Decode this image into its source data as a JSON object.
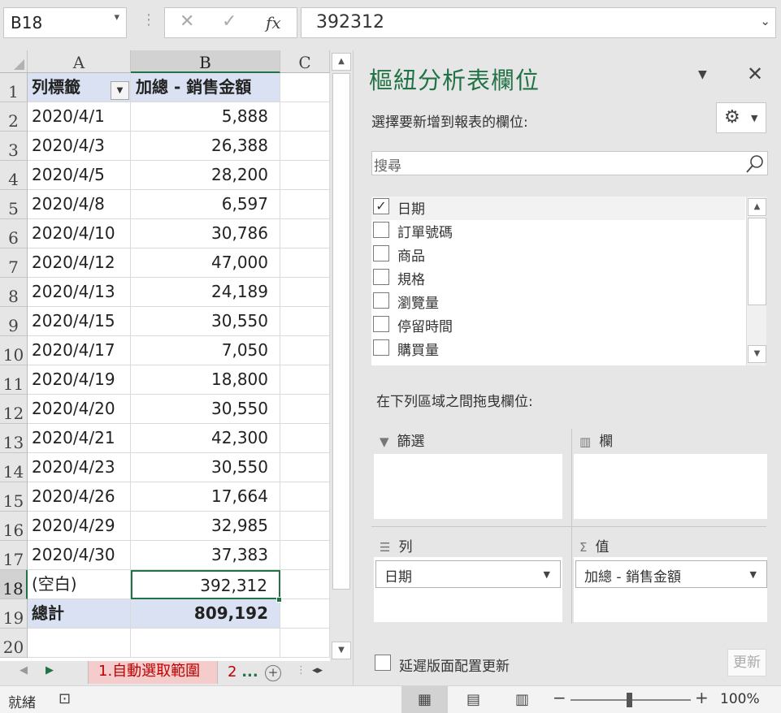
{
  "formula_bar": {
    "name_box": "B18",
    "cancel_glyph": "✕",
    "enter_glyph": "✓",
    "fx_glyph": "fx",
    "formula": "392312"
  },
  "grid": {
    "columns": [
      "A",
      "B",
      "C"
    ],
    "selected_column": "B",
    "rows": [
      {
        "n": "1",
        "a": "列標籤",
        "b": "加總 - 銷售金額",
        "type": "header"
      },
      {
        "n": "2",
        "a": "2020/4/1",
        "b": "5,888"
      },
      {
        "n": "3",
        "a": "2020/4/3",
        "b": "26,388"
      },
      {
        "n": "4",
        "a": "2020/4/5",
        "b": "28,200"
      },
      {
        "n": "5",
        "a": "2020/4/8",
        "b": "6,597"
      },
      {
        "n": "6",
        "a": "2020/4/10",
        "b": "30,786"
      },
      {
        "n": "7",
        "a": "2020/4/12",
        "b": "47,000"
      },
      {
        "n": "8",
        "a": "2020/4/13",
        "b": "24,189"
      },
      {
        "n": "9",
        "a": "2020/4/15",
        "b": "30,550"
      },
      {
        "n": "10",
        "a": "2020/4/17",
        "b": "7,050"
      },
      {
        "n": "11",
        "a": "2020/4/19",
        "b": "18,800"
      },
      {
        "n": "12",
        "a": "2020/4/20",
        "b": "30,550"
      },
      {
        "n": "13",
        "a": "2020/4/21",
        "b": "42,300"
      },
      {
        "n": "14",
        "a": "2020/4/23",
        "b": "30,550"
      },
      {
        "n": "15",
        "a": "2020/4/26",
        "b": "17,664"
      },
      {
        "n": "16",
        "a": "2020/4/29",
        "b": "32,985"
      },
      {
        "n": "17",
        "a": "2020/4/30",
        "b": "37,383"
      },
      {
        "n": "18",
        "a": "(空白)",
        "b": "392,312",
        "type": "selected"
      },
      {
        "n": "19",
        "a": "總計",
        "b": "809,192",
        "type": "total"
      },
      {
        "n": "20",
        "a": "",
        "b": ""
      }
    ]
  },
  "sheet_tabs": {
    "active_tab": "1.自動選取範圍",
    "next_tab": "2",
    "more": "..."
  },
  "pivot": {
    "title": "樞紐分析表欄位",
    "choose_label": "選擇要新增到報表的欄位:",
    "search_placeholder": "搜尋",
    "fields": [
      {
        "label": "日期",
        "checked": true
      },
      {
        "label": "訂單號碼",
        "checked": false
      },
      {
        "label": "商品",
        "checked": false
      },
      {
        "label": "規格",
        "checked": false
      },
      {
        "label": "瀏覽量",
        "checked": false
      },
      {
        "label": "停留時間",
        "checked": false
      },
      {
        "label": "購買量",
        "checked": false
      }
    ],
    "drag_label": "在下列區域之間拖曳欄位:",
    "areas": {
      "filter": "篩選",
      "columns": "欄",
      "rows": "列",
      "values": "值"
    },
    "row_field": "日期",
    "value_field": "加總 - 銷售金額",
    "defer_label": "延遲版面配置更新",
    "update_label": "更新"
  },
  "status_bar": {
    "status": "就緒",
    "zoom": "100%"
  }
}
